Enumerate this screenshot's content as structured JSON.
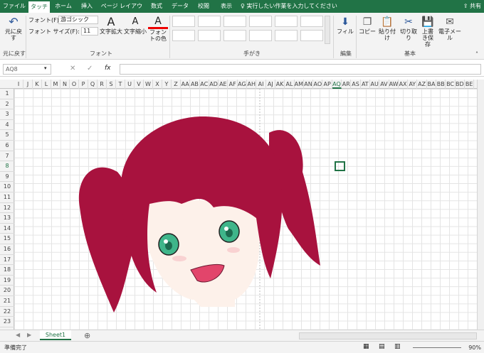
{
  "tabs": [
    "ファイル",
    "タッチ",
    "ホーム",
    "挿入",
    "ページ レイアウト",
    "数式",
    "データ",
    "校閲",
    "表示"
  ],
  "tell_me": "実行したい作業を入力してください",
  "share": "共有",
  "ribbon": {
    "undo": "元に戻す",
    "undo_group": "元に戻す",
    "font_label": "フォント(F):",
    "font_value": "游ゴシック",
    "size_label": "フォント サイズ(F):",
    "size_value": "11",
    "grow": "文字拡大",
    "shrink": "文字縮小",
    "font_color": "フォントの色",
    "font_group": "フォント",
    "ink_group": "手がき",
    "fill": "フィル",
    "edit_group": "編集",
    "copy": "コピー",
    "paste": "貼り付け",
    "cut": "切り取り",
    "overwrite": "上書き保存",
    "email": "電子メール",
    "basic_group": "基本"
  },
  "namebox": "AQ8",
  "fx": "fx",
  "columns": [
    "I",
    "J",
    "K",
    "L",
    "M",
    "N",
    "O",
    "P",
    "Q",
    "R",
    "S",
    "T",
    "U",
    "V",
    "W",
    "X",
    "Y",
    "Z",
    "AA",
    "AB",
    "AC",
    "AD",
    "AE",
    "AF",
    "AG",
    "AH",
    "AI",
    "AJ",
    "AK",
    "AL",
    "AM",
    "AN",
    "AO",
    "AP",
    "AQ",
    "AR",
    "AS",
    "AT",
    "AU",
    "AV",
    "AW",
    "AX",
    "AY",
    "AZ",
    "BA",
    "BB",
    "BC",
    "BD",
    "BE"
  ],
  "selected_column": "AQ",
  "rows": [
    "1",
    "2",
    "3",
    "4",
    "5",
    "6",
    "7",
    "8",
    "9",
    "10",
    "11",
    "12",
    "13",
    "14",
    "15",
    "16",
    "17",
    "18",
    "19",
    "20",
    "21",
    "22",
    "23"
  ],
  "selected_row": "8",
  "sheet": "Sheet1",
  "status": "準備完了",
  "zoom": "90%",
  "colors": {
    "excel_green": "#217346",
    "hair": "#a8123e",
    "eyes": "#3fb58a",
    "skin": "#fdf1ea",
    "mouth": "#e2456b"
  },
  "drawing": {
    "subject": "anime character with crimson twin-tail hair and green eyes drawn with ink"
  }
}
